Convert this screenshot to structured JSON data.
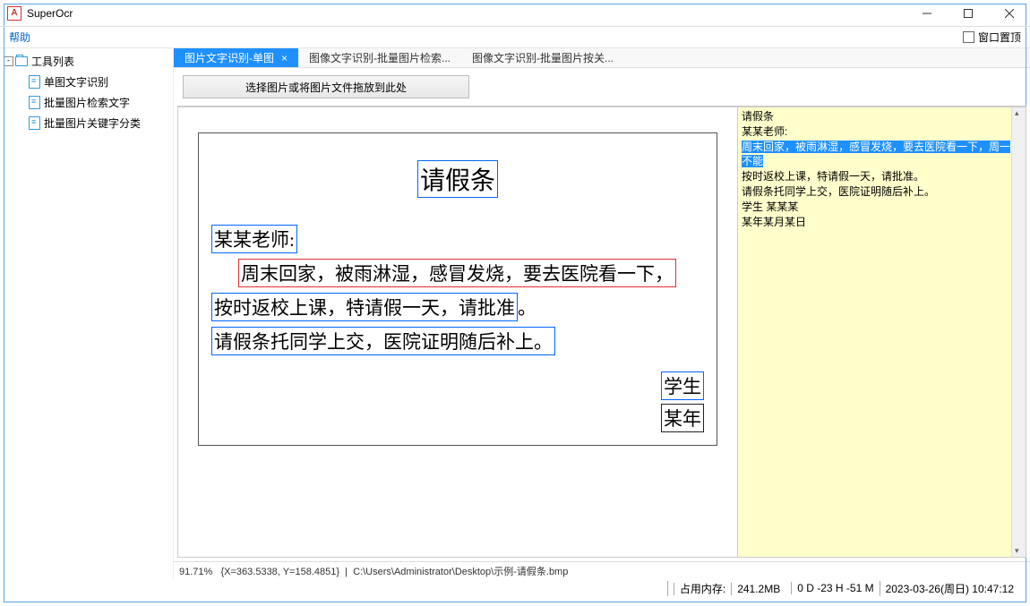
{
  "titlebar": {
    "app_name": "SuperOcr"
  },
  "menu": {
    "help": "帮助",
    "pin_label": "窗口置顶"
  },
  "sidebar": {
    "root": "工具列表",
    "items": [
      {
        "label": "单图文字识别"
      },
      {
        "label": "批量图片检索文字"
      },
      {
        "label": "批量图片关键字分类"
      }
    ]
  },
  "tabs": [
    {
      "label": "图片文字识别-单图",
      "active": true,
      "closable": true
    },
    {
      "label": "图像文字识别-批量图片检索...",
      "active": false
    },
    {
      "label": "图像文字识别-批量图片按关...",
      "active": false
    }
  ],
  "upload": {
    "label": "选择图片或将图片文件拖放到此处"
  },
  "document": {
    "title": "请假条",
    "greeting": "某某老师:",
    "line1": "周末回家，被雨淋湿，感冒发烧，要去医院看一下，",
    "line2": "按时返校上课，特请假一天，请批准",
    "line2_tail": "。",
    "line3": "请假条托同学上交，医院证明随后补上。",
    "sig1": "学生",
    "sig2": "某年"
  },
  "result": {
    "l1": "请假条",
    "l2": "某某老师:",
    "l3": "周末回家，被雨淋湿，感冒发烧，要去医院看一下，周一不能",
    "l4": "按时返校上课，特请假一天，请批准。",
    "l5": "请假条托同学上交，医院证明随后补上。",
    "l6": "学生  某某某",
    "l7": "某年某月某日"
  },
  "substatus": {
    "zoom": "91.71%",
    "coords": "{X=363.5338, Y=158.4851}",
    "path": "C:\\Users\\Administrator\\Desktop\\示例-请假条.bmp"
  },
  "status": {
    "memory_label": "占用内存:",
    "memory_value": "241.2MB",
    "countdown": "0 D -23 H -51 M",
    "datetime": "2023-03-26(周日) 10:47:12"
  }
}
